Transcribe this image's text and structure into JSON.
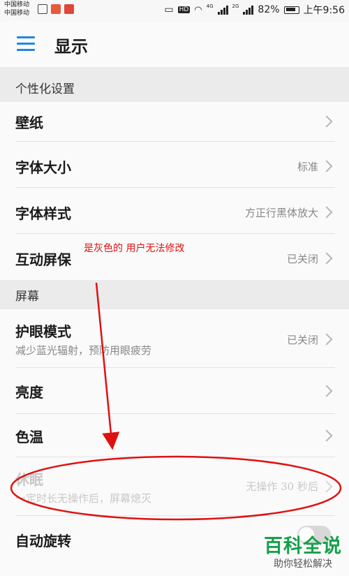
{
  "status_bar": {
    "carrier_1": "中国移动",
    "carrier_2": "中国移动",
    "hd": "HD",
    "net_1": "4G",
    "net_2": "2G",
    "battery": "82%",
    "time": "上午9:56"
  },
  "header": {
    "title": "显示"
  },
  "sections": {
    "personalization": "个性化设置",
    "screen": "屏幕"
  },
  "rows": {
    "wallpaper": {
      "title": "壁纸"
    },
    "font_size": {
      "title": "字体大小",
      "value": "标准"
    },
    "font_style": {
      "title": "字体样式",
      "value": "方正行黑体放大"
    },
    "interactive_screensaver": {
      "title": "互动屏保",
      "value": "已关闭"
    },
    "eye_comfort": {
      "title": "护眼模式",
      "subtitle": "减少蓝光辐射，预防用眼疲劳",
      "value": "已关闭"
    },
    "brightness": {
      "title": "亮度"
    },
    "color_temperature": {
      "title": "色温"
    },
    "sleep": {
      "title": "休眠",
      "subtitle": "一定时长无操作后，屏幕熄灭",
      "value": "无操作 30 秒后",
      "disabled": true
    },
    "auto_rotate": {
      "title": "自动旋转",
      "enabled": false
    }
  },
  "annotation": {
    "text": "是灰色的 用户无法修改",
    "color": "#e01010"
  },
  "watermark": {
    "brand": "百科全说",
    "sub": "助你轻松解决"
  },
  "colors": {
    "accent": "#1e88e5",
    "section_bg": "#ebebeb",
    "watermark_green": "#16a04a"
  }
}
